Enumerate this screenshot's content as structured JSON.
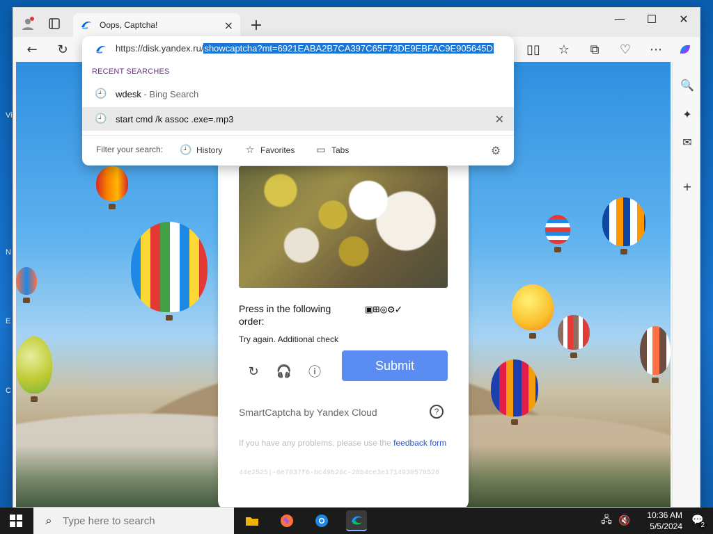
{
  "desktop": {
    "labels": [
      "Vi",
      "N",
      "E",
      "C"
    ]
  },
  "browser": {
    "tab": {
      "title": "Oops, Captcha!"
    },
    "toolbar": {
      "back_icon": "arrow-left-icon",
      "refresh_icon": "refresh-icon"
    },
    "address": {
      "url_prefix": "https://disk.yandex.ru/",
      "url_selected": "showcaptcha?mt=6921EABA2B7CA397C65F73DE9EBFAC9E905645D"
    },
    "dropdown": {
      "recent_heading": "RECENT SEARCHES",
      "suggestions": [
        {
          "text": "wdesk",
          "sub": " - Bing Search",
          "icon": "history-icon"
        },
        {
          "text": "start cmd /k assoc .exe=.mp3",
          "sub": "",
          "icon": "history-icon"
        }
      ],
      "filter_label": "Filter your search:",
      "filters": [
        {
          "label": "History",
          "icon": "history-icon"
        },
        {
          "label": "Favorites",
          "icon": "star-icon"
        },
        {
          "label": "Tabs",
          "icon": "tabs-icon"
        }
      ]
    }
  },
  "captcha": {
    "press_text": "Press in the following order:",
    "order_symbols": "▣⊞◎⚙✓",
    "try_again": "Try again. Additional check",
    "submit_label": "Submit",
    "brand_text": "SmartCaptcha by Yandex Cloud",
    "help_label": "?",
    "problems_prefix": "If you have any problems, please use the ",
    "problems_link": "feedback form",
    "hash": "44e2525|-6e7037f6-bc49b26c-28b4ce3e1714930578526"
  },
  "taskbar": {
    "search_placeholder": "Type here to search",
    "time": "10:36 AM",
    "date": "5/5/2024",
    "notification_count": "2"
  },
  "colors": {
    "accent": "#5b8cf2",
    "selection": "#1976d2",
    "link": "#2b55d6"
  }
}
